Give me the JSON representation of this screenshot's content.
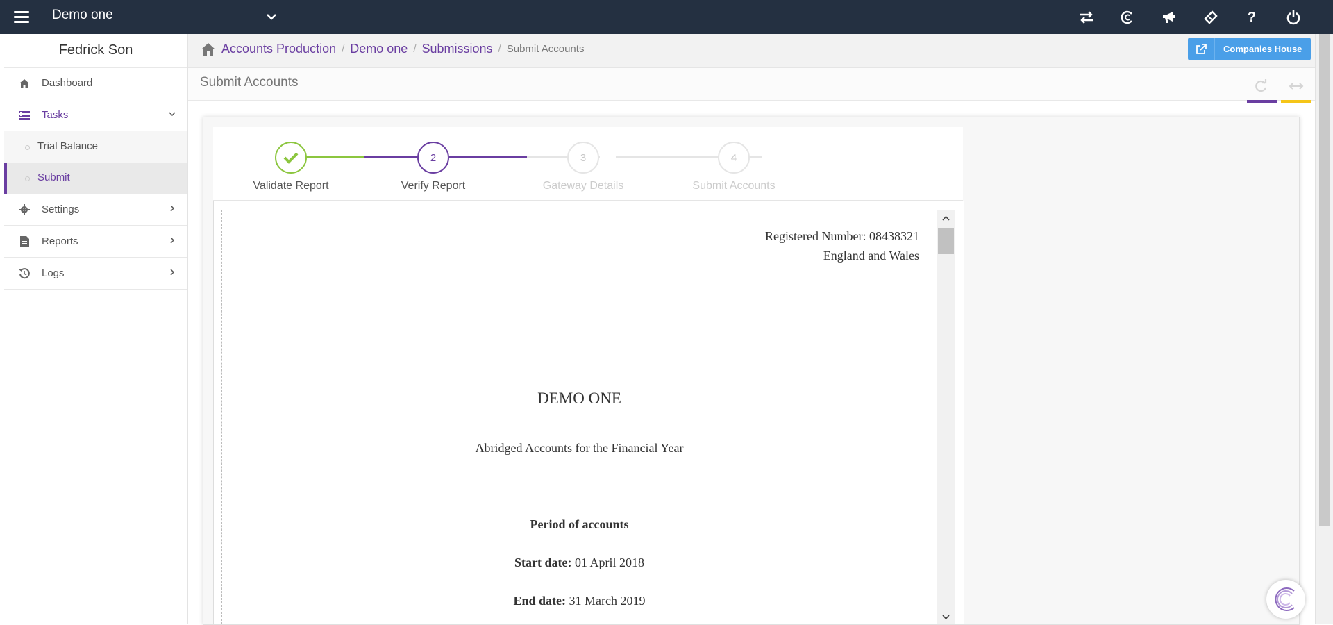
{
  "topbar": {
    "company_name": "Demo one",
    "icons": [
      "swap-icon",
      "copyright-icon",
      "megaphone-icon",
      "ticket-icon",
      "help-icon",
      "power-icon"
    ],
    "help_glyph": "?"
  },
  "sidebar": {
    "user_name": "Fedrick Son",
    "items": [
      {
        "label": "Dashboard",
        "icon": "home-icon"
      },
      {
        "label": "Tasks",
        "icon": "tasks-icon",
        "expanded": true
      },
      {
        "label": "Trial Balance",
        "sub": true
      },
      {
        "label": "Submit",
        "sub": true,
        "active": true
      },
      {
        "label": "Settings",
        "icon": "gear-icon"
      },
      {
        "label": "Reports",
        "icon": "file-icon"
      },
      {
        "label": "Logs",
        "icon": "history-icon"
      }
    ]
  },
  "breadcrumb": {
    "items": [
      "Accounts Production",
      "Demo one",
      "Submissions"
    ],
    "current": "Submit Accounts",
    "separator": "/"
  },
  "companies_house_button": {
    "label": "Companies House"
  },
  "page": {
    "title": "Submit Accounts"
  },
  "colors": {
    "topbar": "#243041",
    "accent_purple": "#6a3ea1",
    "accent_yellow": "#f5c518",
    "step_done": "#8cc63f",
    "button_blue": "#4a9fe8"
  },
  "wizard": {
    "steps": [
      {
        "number": "1",
        "label": "Validate Report",
        "state": "done"
      },
      {
        "number": "2",
        "label": "Verify Report",
        "state": "active"
      },
      {
        "number": "3",
        "label": "Gateway Details",
        "state": "pending"
      },
      {
        "number": "4",
        "label": "Submit Accounts",
        "state": "pending"
      }
    ]
  },
  "document": {
    "registered_number": "Registered Number: 08438321",
    "jurisdiction": "England and Wales",
    "company_title": "DEMO ONE",
    "subtitle": "Abridged Accounts for the Financial Year",
    "period_heading": "Period of accounts",
    "start_label": "Start date:",
    "start_value": "01 April 2018",
    "end_label": "End date:",
    "end_value": "31 March 2019"
  }
}
